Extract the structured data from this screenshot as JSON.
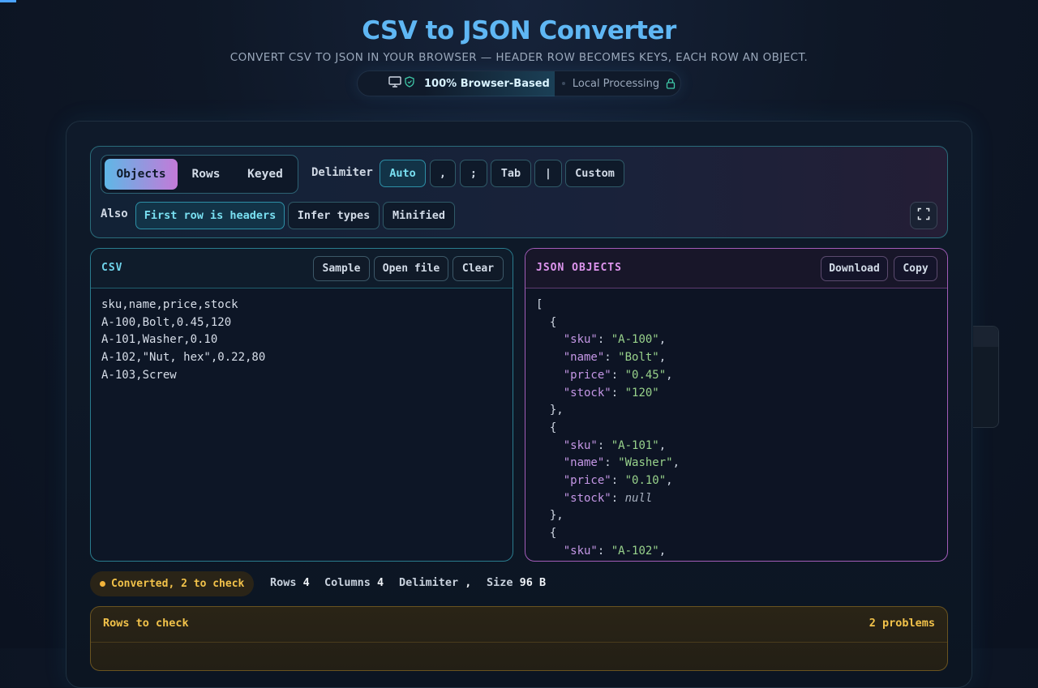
{
  "header": {
    "title": "CSV to JSON Converter",
    "subtitle": "CONVERT CSV TO JSON IN YOUR BROWSER — HEADER ROW BECOMES KEYS, EACH ROW AN OBJECT.",
    "badge_main": "100% Browser-Based",
    "badge_secondary": "Local Processing",
    "icons": [
      "monitor-icon",
      "shield-icon",
      "lock-icon"
    ]
  },
  "toolbar": {
    "modes": [
      {
        "label": "Objects",
        "active": true
      },
      {
        "label": "Rows",
        "active": false
      },
      {
        "label": "Keyed",
        "active": false
      }
    ],
    "delimiter_label": "Delimiter",
    "delimiters": [
      {
        "label": "Auto",
        "active": true
      },
      {
        "label": ",",
        "active": false
      },
      {
        "label": ";",
        "active": false
      },
      {
        "label": "Tab",
        "active": false
      },
      {
        "label": "|",
        "active": false
      },
      {
        "label": "Custom",
        "active": false
      }
    ],
    "also_label": "Also",
    "options": [
      {
        "label": "First row is headers",
        "active": true
      },
      {
        "label": "Infer types",
        "active": false
      },
      {
        "label": "Minified",
        "active": false
      }
    ],
    "expand_icon": "fullscreen-icon"
  },
  "csv_panel": {
    "title": "CSV",
    "buttons": [
      "Sample",
      "Open file",
      "Clear"
    ],
    "lines": [
      "sku,name,price,stock",
      "A-100,Bolt,0.45,120",
      "A-101,Washer,0.10",
      "A-102,\"Nut, hex\",0.22,80",
      "A-103,Screw"
    ]
  },
  "json_panel": {
    "title": "JSON OBJECTS",
    "buttons": [
      "Download",
      "Copy"
    ],
    "open_bracket": "[",
    "objects": [
      {
        "fields": [
          {
            "key": "\"sku\"",
            "value": "\"A-100\"",
            "comma": true
          },
          {
            "key": "\"name\"",
            "value": "\"Bolt\"",
            "comma": true
          },
          {
            "key": "\"price\"",
            "value": "\"0.45\"",
            "comma": true
          },
          {
            "key": "\"stock\"",
            "value": "\"120\"",
            "comma": false
          }
        ]
      },
      {
        "fields": [
          {
            "key": "\"sku\"",
            "value": "\"A-101\"",
            "comma": true
          },
          {
            "key": "\"name\"",
            "value": "\"Washer\"",
            "comma": true
          },
          {
            "key": "\"price\"",
            "value": "\"0.10\"",
            "comma": true
          },
          {
            "key": "\"stock\"",
            "value": "null",
            "comma": false,
            "null": true
          }
        ]
      },
      {
        "fields": [
          {
            "key": "\"sku\"",
            "value": "\"A-102\"",
            "comma": true
          }
        ]
      }
    ]
  },
  "status": {
    "message": "Converted, 2 to check",
    "rows_label": "Rows",
    "rows_value": "4",
    "columns_label": "Columns",
    "columns_value": "4",
    "delimiter_label": "Delimiter",
    "delimiter_value": ",",
    "size_label": "Size",
    "size_value": "96 B"
  },
  "checks": {
    "title": "Rows to check",
    "count": "2 problems"
  },
  "colors": {
    "accent_cyan": "#5fb7f4",
    "accent_purple": "#de95ee",
    "warning": "#f2c24a",
    "json_key": "#c597e6",
    "json_string": "#98d28b"
  }
}
